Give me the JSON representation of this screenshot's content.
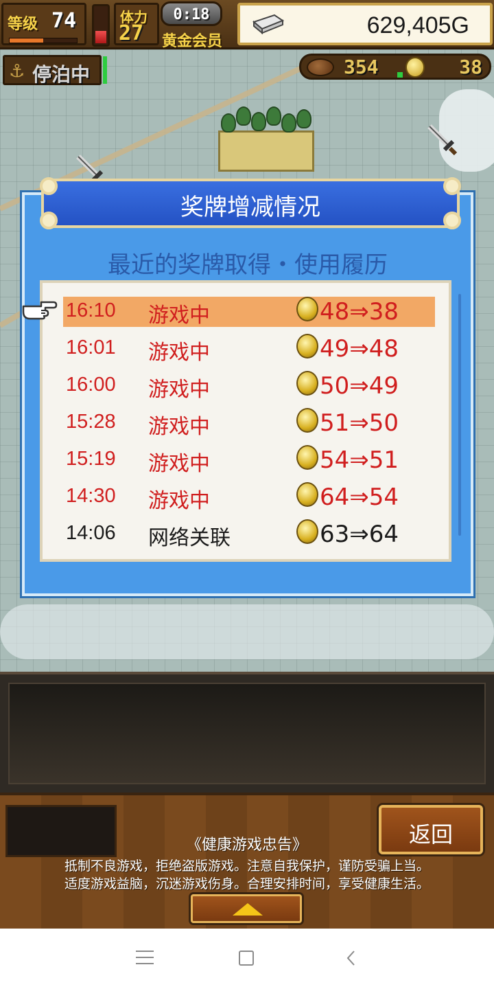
{
  "hud": {
    "level_label": "等级",
    "level_value": "74",
    "level_progress": 0.5,
    "stamina_label": "体力",
    "stamina_value": "27",
    "stamina_gauge_level": 0.35,
    "timer": "0:18",
    "member_label": "黄金会员",
    "gold_value": "629,405G",
    "moored_label": "停泊中",
    "resource_1": "354",
    "medal_count": "38"
  },
  "dialog": {
    "title": "奖牌增减情况",
    "subtitle": "最近的奖牌取得・使用履历",
    "rows": [
      {
        "time": "16:10",
        "reason": "游戏中",
        "change": "48⇒38",
        "highlight": true,
        "color": "#d01e1e"
      },
      {
        "time": "16:01",
        "reason": "游戏中",
        "change": "49⇒48",
        "highlight": false,
        "color": "#d01e1e"
      },
      {
        "time": "16:00",
        "reason": "游戏中",
        "change": "50⇒49",
        "highlight": false,
        "color": "#d01e1e"
      },
      {
        "time": "15:28",
        "reason": "游戏中",
        "change": "51⇒50",
        "highlight": false,
        "color": "#d01e1e"
      },
      {
        "time": "15:19",
        "reason": "游戏中",
        "change": "54⇒51",
        "highlight": false,
        "color": "#d01e1e"
      },
      {
        "time": "14:30",
        "reason": "游戏中",
        "change": "64⇒54",
        "highlight": false,
        "color": "#d01e1e"
      },
      {
        "time": "14:06",
        "reason": "网络关联",
        "change": "63⇒64",
        "highlight": false,
        "color": "#1a1a1a"
      }
    ]
  },
  "bottom": {
    "back_label": "返回",
    "health_title": "《健康游戏忠告》",
    "health_line1": "抵制不良游戏，拒绝盗版游戏。注意自我保护，谨防受骗上当。",
    "health_line2": "适度游戏益脑，沉迷游戏伤身。合理安排时间，享受健康生活。"
  },
  "icons": {
    "anchor": "anchor-icon",
    "silver": "silver-bar-icon",
    "medal": "medal-icon",
    "pointer": "pointing-hand-icon",
    "sword": "sword-icon",
    "up_arrow": "up-arrow-icon"
  },
  "colors": {
    "dialog_blue": "#4a9ae8",
    "highlight_row": "#f2a865",
    "red_text": "#d01e1e"
  }
}
